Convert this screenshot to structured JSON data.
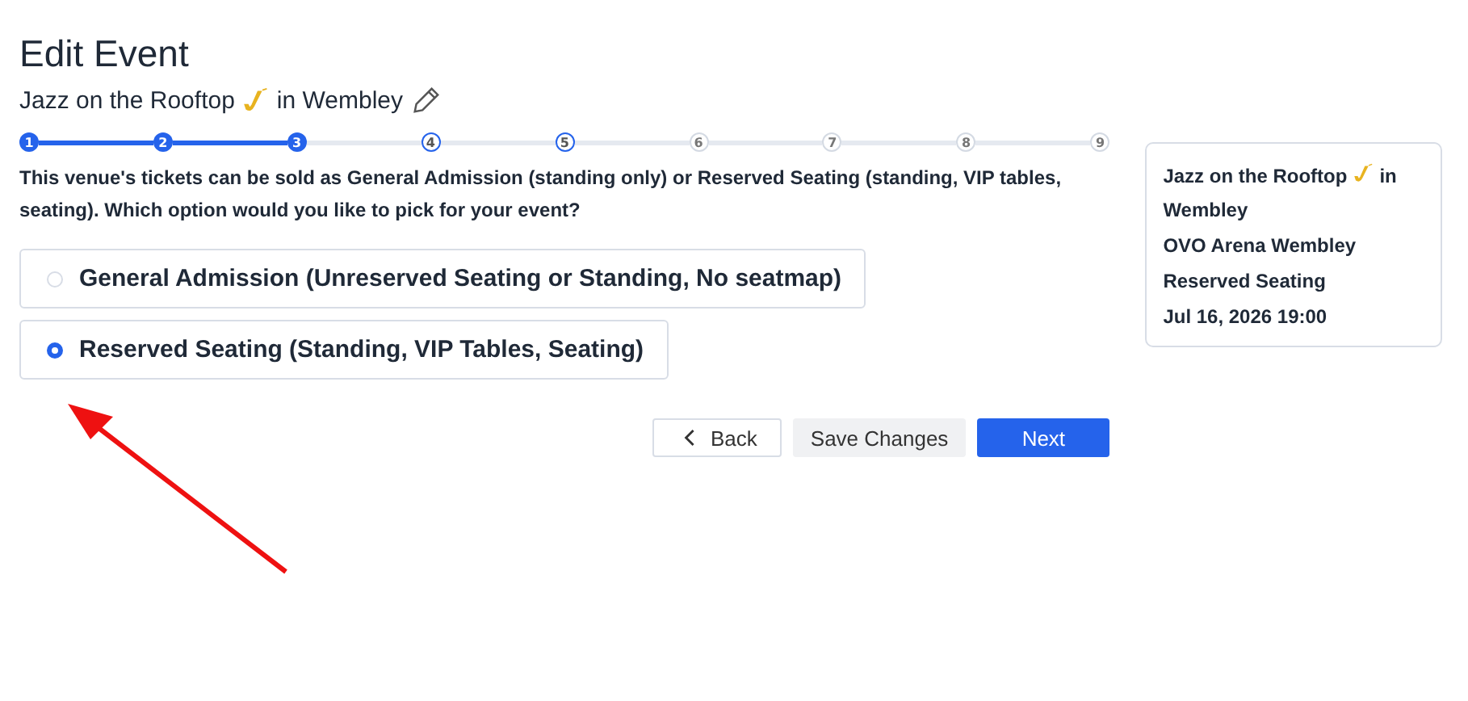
{
  "title": "Edit Event",
  "event_name": {
    "before": "Jazz on the Rooftop",
    "after": "in Wembley"
  },
  "steps": [
    {
      "label": "1",
      "completed": true,
      "available": true
    },
    {
      "label": "2",
      "completed": true,
      "available": true
    },
    {
      "label": "3",
      "completed": true,
      "available": true
    },
    {
      "label": "4",
      "completed": false,
      "available": true
    },
    {
      "label": "5",
      "completed": false,
      "available": true
    },
    {
      "label": "6",
      "completed": false,
      "available": false
    },
    {
      "label": "7",
      "completed": false,
      "available": false
    },
    {
      "label": "8",
      "completed": false,
      "available": false
    },
    {
      "label": "9",
      "completed": false,
      "available": false
    }
  ],
  "question": "This venue's tickets can be sold as General Admission (standing only) or Reserved Seating (standing, VIP tables, seating). Which option would you like to pick for your event?",
  "options": [
    {
      "label": "General Admission (Unreserved Seating or Standing, No seatmap)",
      "selected": false
    },
    {
      "label": "Reserved Seating (Standing, VIP Tables, Seating)",
      "selected": true
    }
  ],
  "buttons": {
    "back": "Back",
    "save": "Save Changes",
    "next": "Next"
  },
  "summary": {
    "name_before": "Jazz on the Rooftop",
    "name_after": "in Wembley",
    "venue": "OVO Arena Wembley",
    "seating": "Reserved Seating",
    "date": "Jul 16, 2026 19:00"
  }
}
